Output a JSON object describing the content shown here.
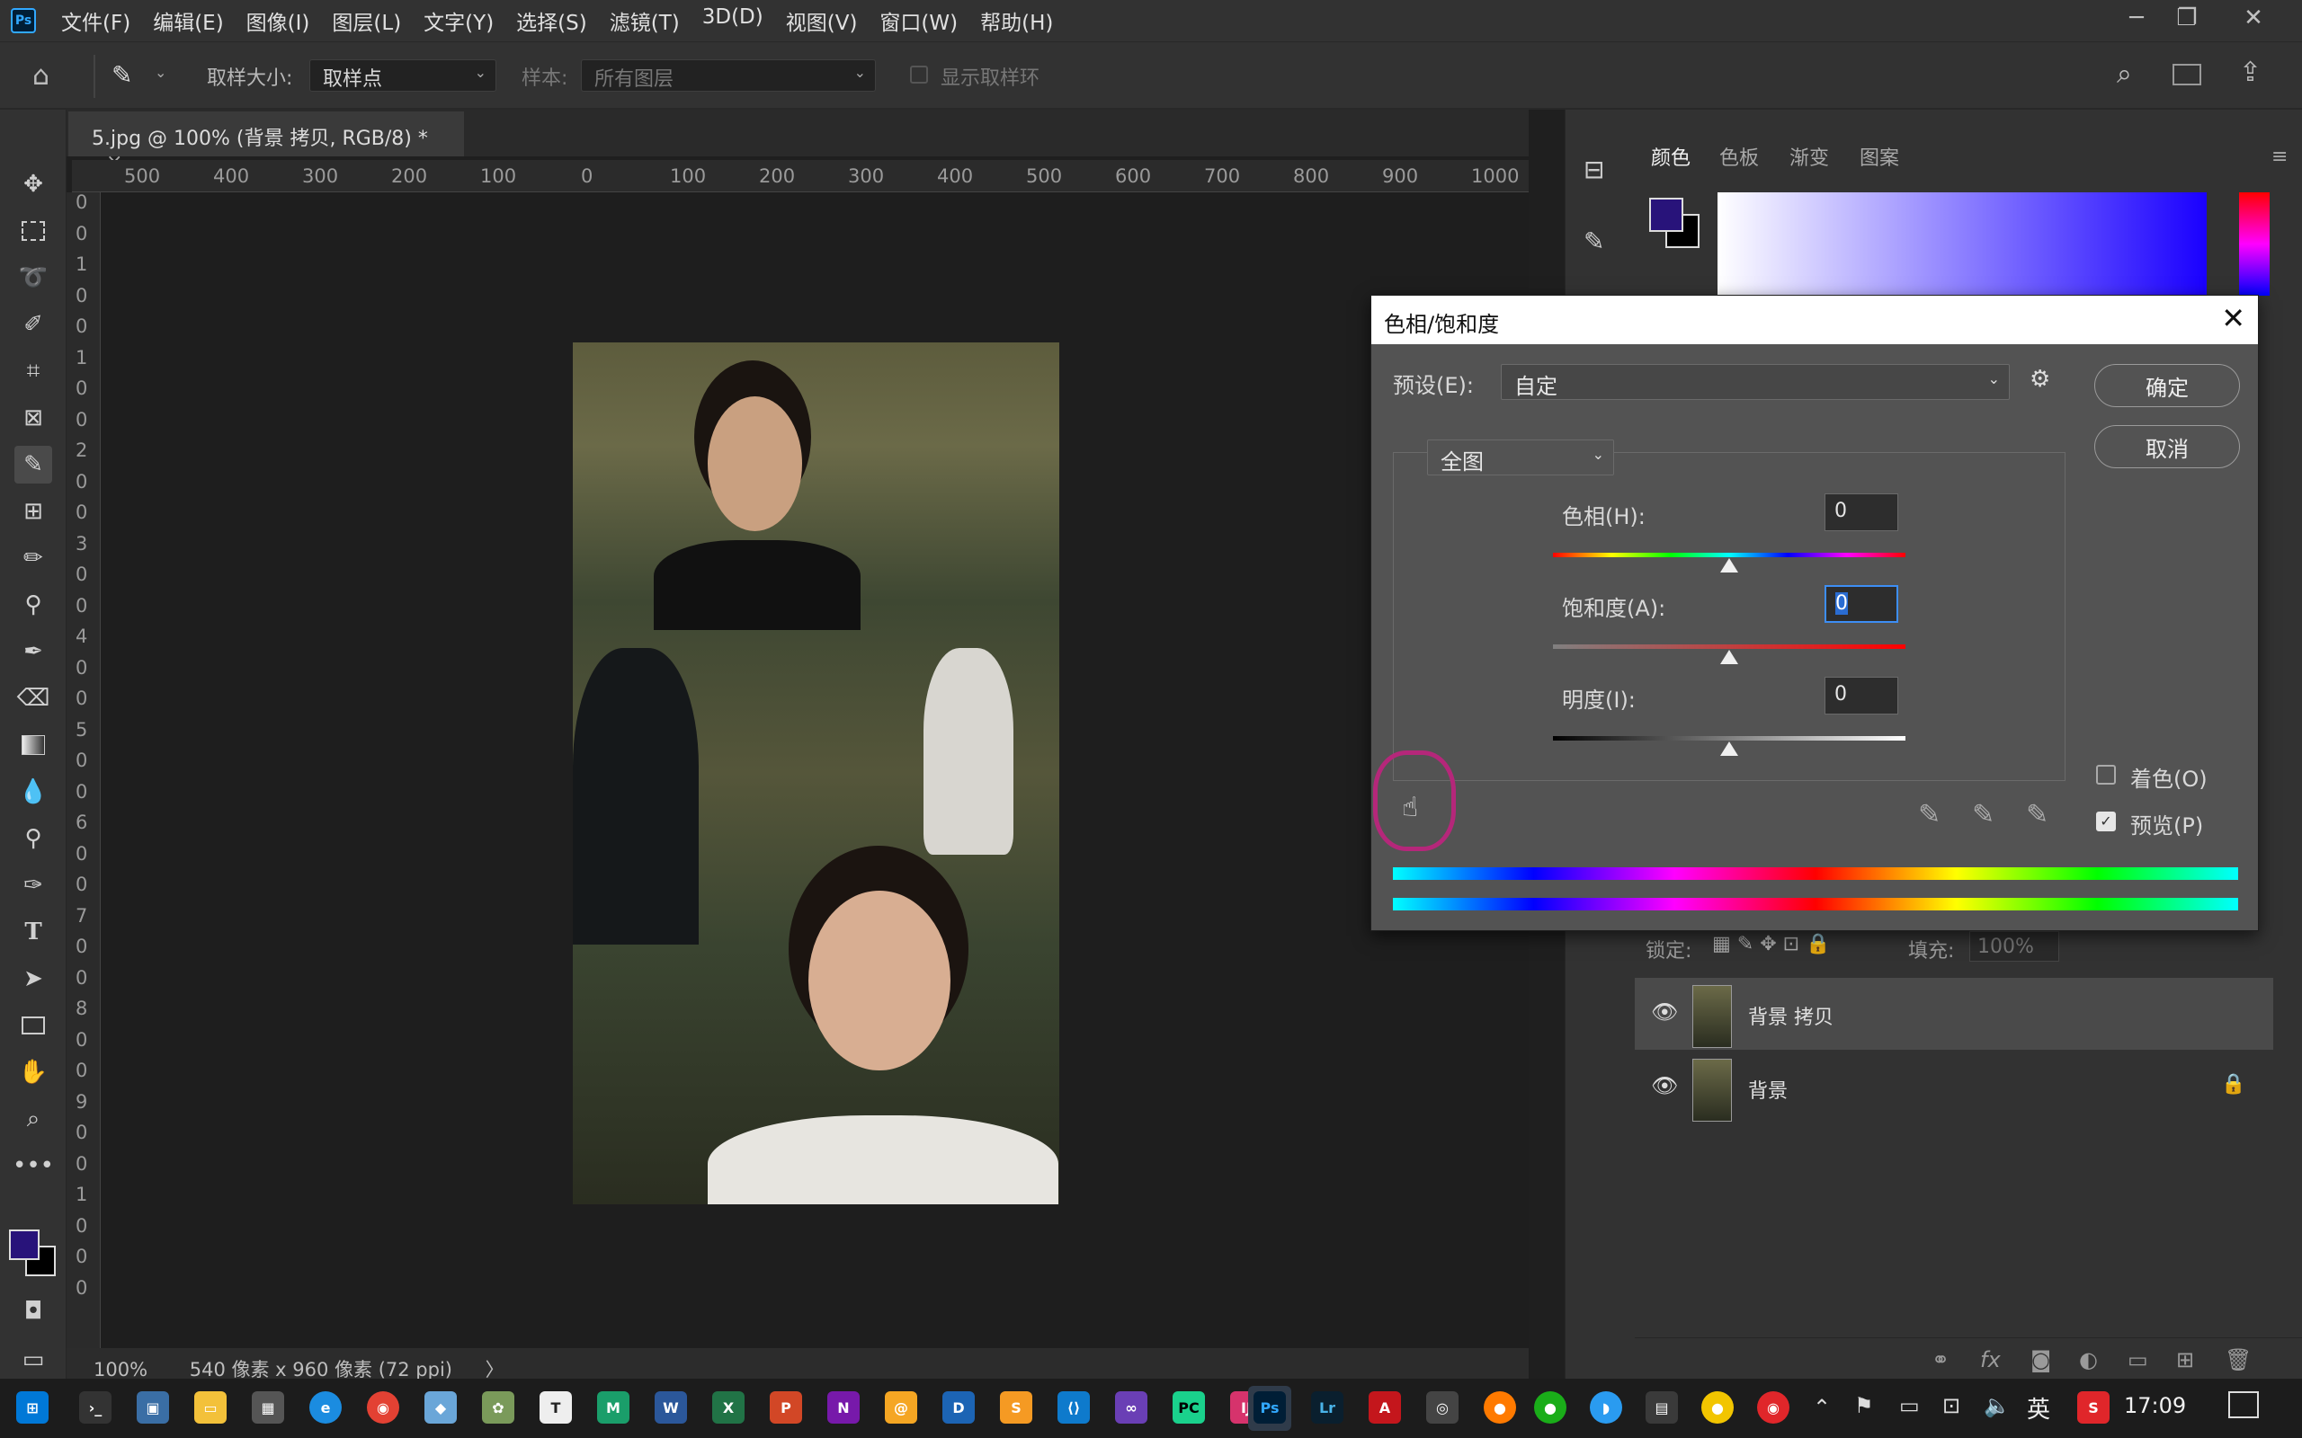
{
  "app": {
    "logo": "Ps",
    "menus": [
      "文件(F)",
      "编辑(E)",
      "图像(I)",
      "图层(L)",
      "文字(Y)",
      "选择(S)",
      "滤镜(T)",
      "3D(D)",
      "视图(V)",
      "窗口(W)",
      "帮助(H)"
    ],
    "window_controls": {
      "minimize": "─",
      "restore": "❐",
      "close": "✕"
    }
  },
  "options_bar": {
    "sample_size_label": "取样大小:",
    "sample_size_value": "取样点",
    "sample_label": "样本:",
    "sample_value": "所有图层",
    "show_ring_label": "显示取样环"
  },
  "document": {
    "tab_title": "5.jpg @ 100% (背景 拷贝, RGB/8) *",
    "tab_close": "×",
    "ruler_h": [
      "500",
      "400",
      "300",
      "200",
      "100",
      "0",
      "100",
      "200",
      "300",
      "400",
      "500",
      "600",
      "700",
      "800",
      "900",
      "1000"
    ],
    "ruler_v": [
      "0",
      "0",
      "1",
      "0",
      "0",
      "1",
      "0",
      "0",
      "2",
      "0",
      "0",
      "3",
      "0",
      "0",
      "4",
      "0",
      "0",
      "5",
      "0",
      "0",
      "6",
      "0",
      "0",
      "7",
      "0",
      "0",
      "8",
      "0",
      "0",
      "9",
      "0",
      "0",
      "1",
      "0",
      "0",
      "0"
    ],
    "zoom": "100%",
    "size_info": "540 像素 x 960 像素 (72 ppi)",
    "status_arrow": "〉"
  },
  "color_panel": {
    "tabs": [
      "颜色",
      "色板",
      "渐变",
      "图案"
    ],
    "foreground": "#28137a",
    "background": "#000000"
  },
  "layers_panel": {
    "lock_label": "锁定:",
    "fill_label": "填充:",
    "fill_value": "100%",
    "layers": [
      {
        "name": "背景 拷贝",
        "selected": true,
        "locked": false
      },
      {
        "name": "背景",
        "selected": false,
        "locked": true
      }
    ]
  },
  "dialog": {
    "title": "色相/饱和度",
    "close": "✕",
    "preset_label": "预设(E):",
    "preset_value": "自定",
    "ok_label": "确定",
    "cancel_label": "取消",
    "range_value": "全图",
    "hue_label": "色相(H):",
    "hue_value": "0",
    "saturation_label": "饱和度(A):",
    "saturation_value": "0",
    "lightness_label": "明度(I):",
    "lightness_value": "0",
    "colorize_label": "着色(O)",
    "colorize_checked": false,
    "preview_label": "预览(P)",
    "preview_checked": true,
    "gear_icon": "⚙"
  },
  "taskbar": {
    "time": "17:09",
    "ime": "英"
  }
}
